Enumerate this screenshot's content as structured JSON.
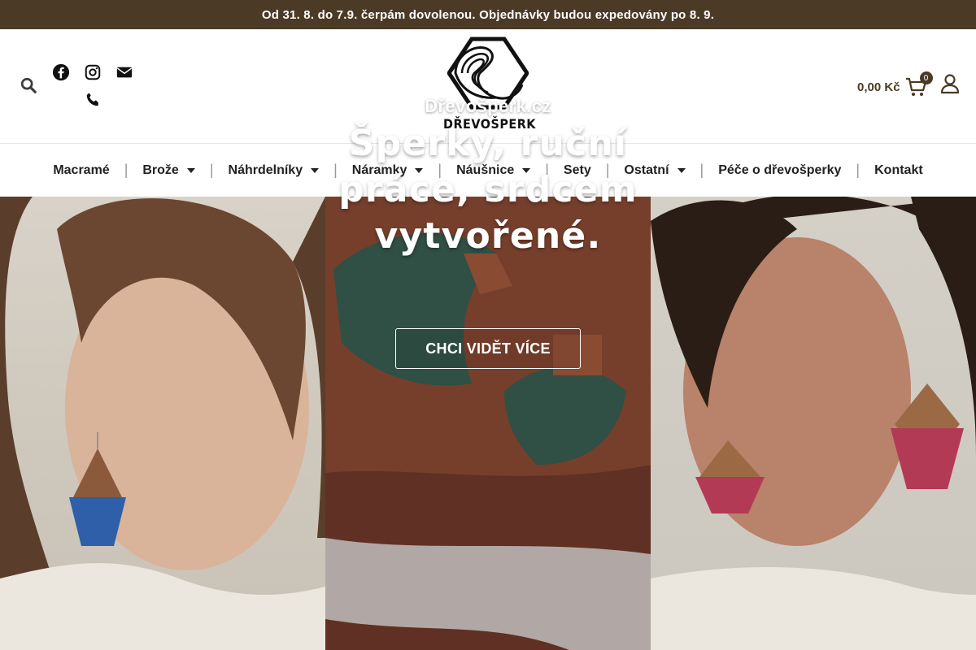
{
  "topbar": {
    "announcement": "Od 31. 8. do 7.9. čerpám dovolenou. Objednávky budou expedovány po 8. 9."
  },
  "header": {
    "logo_text": "DŘEVOŠPERK",
    "icons": {
      "search": "search-icon",
      "facebook": "facebook-icon",
      "instagram": "instagram-icon",
      "email": "envelope-icon",
      "phone": "phone-icon",
      "cart": "shopping-cart-icon",
      "user": "user-icon"
    },
    "cart_amount": "0,00 Kč",
    "cart_count": "0"
  },
  "nav": {
    "items": [
      {
        "label": "Macramé ",
        "has_dropdown": false
      },
      {
        "label": "Brože",
        "has_dropdown": true
      },
      {
        "label": "Náhrdelníky",
        "has_dropdown": true
      },
      {
        "label": "Náramky",
        "has_dropdown": true
      },
      {
        "label": "Náušnice",
        "has_dropdown": true
      },
      {
        "label": "Sety",
        "has_dropdown": false
      },
      {
        "label": "Ostatní",
        "has_dropdown": true
      },
      {
        "label": "Péče o dřevošperky",
        "has_dropdown": false
      },
      {
        "label": "Kontakt",
        "has_dropdown": false
      }
    ]
  },
  "hero": {
    "eyebrow": "Dřevošperk.cz",
    "title": "Šperky, ruční práce, srdcem vytvořené.",
    "cta_label": "CHCI VIDĚT VÍCE"
  },
  "colors": {
    "brand_brown": "#4a3a26",
    "white": "#ffffff"
  }
}
